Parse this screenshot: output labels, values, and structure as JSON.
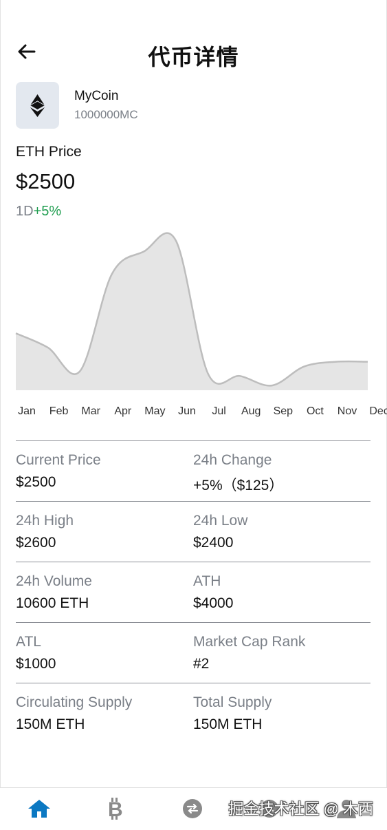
{
  "header": {
    "title": "代币详情"
  },
  "coin": {
    "name": "MyCoin",
    "supply": "1000000MC",
    "icon": "ethereum-icon"
  },
  "price": {
    "label": "ETH Price",
    "value": "$2500",
    "period": "1D",
    "change": "+5%"
  },
  "chart_data": {
    "type": "area",
    "x": [
      "Jan",
      "Feb",
      "Mar",
      "Apr",
      "May",
      "Jun",
      "Jul",
      "Aug",
      "Sep",
      "Oct",
      "Nov",
      "Dec"
    ],
    "values": [
      2000,
      1940,
      1840,
      2250,
      2345,
      2390,
      1830,
      1820,
      1780,
      1860,
      1880,
      1880
    ],
    "xlabel": "",
    "ylabel": "",
    "grid": false,
    "colors": {
      "fill": "#e5e5e5",
      "line": "#bdbdbd"
    }
  },
  "stats": [
    {
      "left": {
        "label": "Current Price",
        "value": "$2500"
      },
      "right": {
        "label": "24h Change",
        "value": "+5%（$125）"
      }
    },
    {
      "left": {
        "label": "24h High",
        "value": "$2600"
      },
      "right": {
        "label": "24h Low",
        "value": "$2400"
      }
    },
    {
      "left": {
        "label": "24h Volume",
        "value": "10600 ETH"
      },
      "right": {
        "label": "ATH",
        "value": "$4000"
      }
    },
    {
      "left": {
        "label": "ATL",
        "value": "$1000"
      },
      "right": {
        "label": "Market Cap Rank",
        "value": "#2"
      }
    },
    {
      "left": {
        "label": "Circulating Supply",
        "value": "150M ETH"
      },
      "right": {
        "label": "Total Supply",
        "value": "150M ETH"
      }
    }
  ],
  "tabs": [
    {
      "icon": "home-icon",
      "active": true
    },
    {
      "icon": "bitcoin-icon",
      "active": false
    },
    {
      "icon": "swap-icon",
      "active": false
    },
    {
      "icon": "history-icon",
      "active": false
    },
    {
      "icon": "user-icon",
      "active": false
    }
  ],
  "colors": {
    "accent": "#0b78c2",
    "inactive_icon": "#8a8a8a",
    "positive": "#1f9d4f"
  },
  "watermark": "掘金技术社区 @ 木西"
}
